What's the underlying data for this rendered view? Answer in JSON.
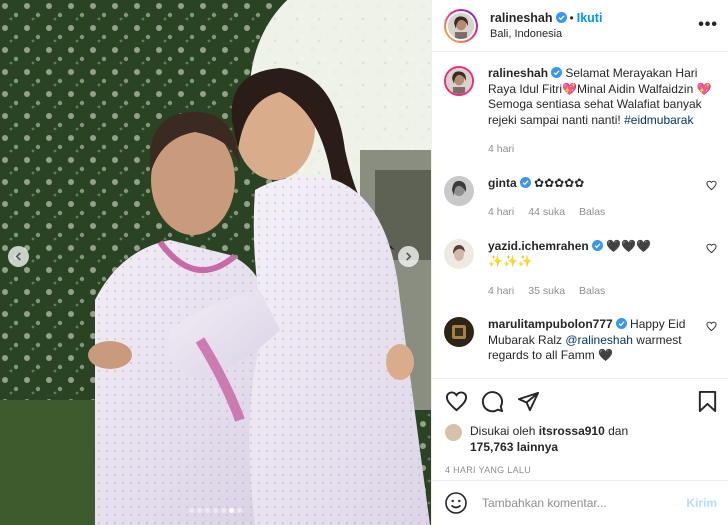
{
  "post": {
    "username": "ralineshah",
    "follow_label": "Ikuti",
    "separator": "•",
    "location": "Bali, Indonesia",
    "more_label": "•••"
  },
  "photo": {
    "carousel_count": 7,
    "carousel_active_index": 5
  },
  "caption": {
    "username": "ralineshah",
    "text": "Selamat Merayakan Hari Raya Idul Fitri💖Minal Aidin Walfaidzin 💖 Semoga sentiasa sehat Walafiat banyak rejeki sampai nanti nanti!",
    "hashtag": "#eidmubarak",
    "time": "4 hari"
  },
  "comments": [
    {
      "username": "ginta",
      "text": "✿✿✿✿✿",
      "time": "4 hari",
      "likes": "44 suka",
      "reply": "Balas"
    },
    {
      "username": "yazid.ichemrahen",
      "text": "🖤🖤🖤✨✨✨",
      "time": "4 hari",
      "likes": "35 suka",
      "reply": "Balas"
    },
    {
      "username": "marulitampubolon777",
      "text_before": "Happy Eid Mubarak Ralz",
      "mention": "@ralineshah",
      "text_after": "warmest regards to all Famm 🖤"
    }
  ],
  "likes": {
    "prefix": "Disukai oleh",
    "user": "itsrossa910",
    "and": "dan",
    "count": "175,763",
    "suffix": "lainnya"
  },
  "timestamp": "4 HARI YANG LALU",
  "add_comment": {
    "placeholder": "Tambahkan komentar...",
    "post_label": "Kirim"
  },
  "colors": {
    "accent": "#0095f6",
    "verified": "#3897f0",
    "muted": "#8e8e8e",
    "post_disabled": "#b2dffc"
  }
}
